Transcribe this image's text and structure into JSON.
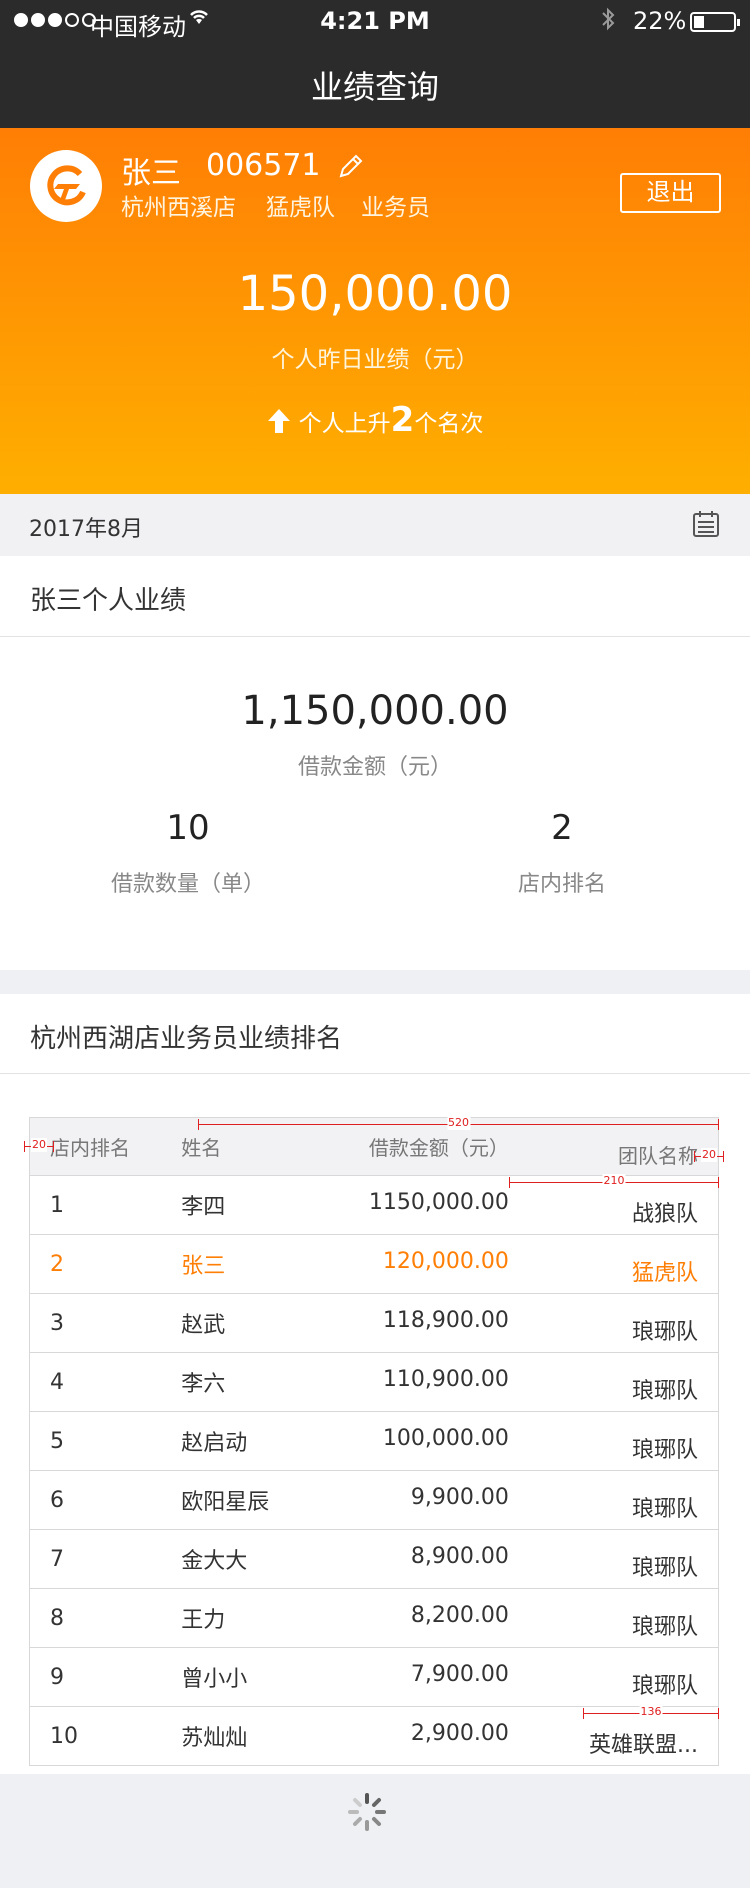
{
  "status_bar": {
    "carrier": "中国移动",
    "time": "4:21 PM",
    "battery": "22%",
    "wifi_icon": "wifi-icon",
    "bluetooth_icon": "bluetooth-icon"
  },
  "nav": {
    "title": "业绩查询"
  },
  "user": {
    "name": "张三",
    "id": "006571",
    "store": "杭州西溪店",
    "team": "猛虎队",
    "role": "业务员",
    "logout_label": "退出"
  },
  "hero": {
    "amount": "150,000.00",
    "amount_label": "个人昨日业绩（元）",
    "rank_prefix": "个人上升",
    "rank_change": "2",
    "rank_suffix": "个名次"
  },
  "month": "2017年8月",
  "personal": {
    "title": "张三个人业绩",
    "loan_amount": "1,150,000.00",
    "loan_amount_label": "借款金额（元）",
    "loan_count": "10",
    "loan_count_label": "借款数量（单）",
    "store_rank": "2",
    "store_rank_label": "店内排名"
  },
  "ranking": {
    "title": "杭州西湖店业务员业绩排名",
    "headers": [
      "店内排名",
      "姓名",
      "借款金额（元）",
      "团队名称"
    ],
    "rows": [
      [
        "1",
        "李四",
        "1150,000.00",
        "战狼队"
      ],
      [
        "2",
        "张三",
        "120,000.00",
        "猛虎队"
      ],
      [
        "3",
        "赵武",
        "118,900.00",
        "琅琊队"
      ],
      [
        "4",
        "李六",
        "110,900.00",
        "琅琊队"
      ],
      [
        "5",
        "赵启动",
        "100,000.00",
        "琅琊队"
      ],
      [
        "6",
        "欧阳星辰",
        "9,900.00",
        "琅琊队"
      ],
      [
        "7",
        "金大大",
        "8,900.00",
        "琅琊队"
      ],
      [
        "8",
        "王力",
        "8,200.00",
        "琅琊队"
      ],
      [
        "9",
        "曾小小",
        "7,900.00",
        "琅琊队"
      ],
      [
        "10",
        "苏灿灿",
        "2,900.00",
        "英雄联盟..."
      ]
    ],
    "highlight_color": "#ff7e05"
  },
  "measurements": {
    "m520": "520",
    "m20a": "20",
    "m20b": "20",
    "m210": "210",
    "m136": "136"
  },
  "colors": {
    "nav_bg": "#2b2b2c",
    "hero_top": "#ff7e05",
    "hero_bottom": "#ffaf00",
    "accent": "#ff7e05"
  }
}
